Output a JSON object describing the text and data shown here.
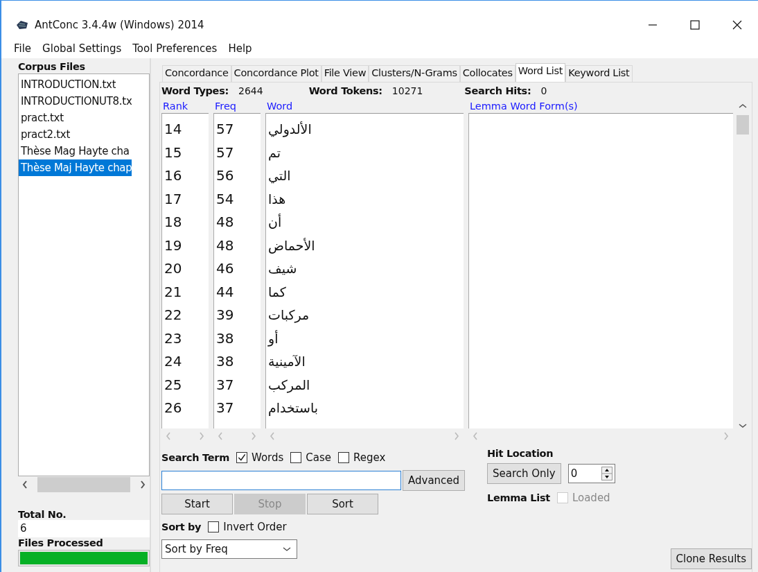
{
  "window": {
    "title": "AntConc 3.4.4w (Windows) 2014"
  },
  "menu": [
    "File",
    "Global Settings",
    "Tool Preferences",
    "Help"
  ],
  "corpus": {
    "title": "Corpus Files",
    "files": [
      {
        "name": "INTRODUCTION.txt",
        "selected": false
      },
      {
        "name": "INTRODUCTIONUT8.tx",
        "selected": false
      },
      {
        "name": "pract.txt",
        "selected": false
      },
      {
        "name": "pract2.txt",
        "selected": false
      },
      {
        "name": "Thèse Mag Hayte cha",
        "selected": false
      },
      {
        "name": "Thèse Maj Hayte chap",
        "selected": true
      }
    ],
    "total_label": "Total No.",
    "total": "6",
    "processed_label": "Files Processed",
    "level": 1
  },
  "tabs": [
    {
      "label": "Concordance",
      "selected": false
    },
    {
      "label": "Concordance Plot",
      "selected": false
    },
    {
      "label": "File View",
      "selected": false
    },
    {
      "label": "Clusters/N-Grams",
      "selected": false
    },
    {
      "label": "Collocates",
      "selected": false
    },
    {
      "label": "Word List",
      "selected": true
    },
    {
      "label": "Keyword List",
      "selected": false
    }
  ],
  "stats": [
    {
      "label": "Word Types:",
      "value": "2644"
    },
    {
      "label": "Word Tokens:",
      "value": "10271"
    },
    {
      "label": "Search Hits:",
      "value": "0"
    }
  ],
  "columns": [
    "Rank",
    "Freq",
    "Word",
    "Lemma Word Form(s)"
  ],
  "rows": [
    {
      "rank": "14",
      "freq": "57",
      "word": "الألدولي"
    },
    {
      "rank": "15",
      "freq": "57",
      "word": "تم"
    },
    {
      "rank": "16",
      "freq": "56",
      "word": "التي"
    },
    {
      "rank": "17",
      "freq": "54",
      "word": "هذا"
    },
    {
      "rank": "18",
      "freq": "48",
      "word": "أن"
    },
    {
      "rank": "19",
      "freq": "48",
      "word": "الأحماض"
    },
    {
      "rank": "20",
      "freq": "46",
      "word": "شيف"
    },
    {
      "rank": "21",
      "freq": "44",
      "word": "كما"
    },
    {
      "rank": "22",
      "freq": "39",
      "word": "مركبات"
    },
    {
      "rank": "23",
      "freq": "38",
      "word": "أو"
    },
    {
      "rank": "24",
      "freq": "38",
      "word": "الآمينية"
    },
    {
      "rank": "25",
      "freq": "37",
      "word": "المركب"
    },
    {
      "rank": "26",
      "freq": "37",
      "word": "باستخدام"
    }
  ],
  "search": {
    "label": "Search Term",
    "options": [
      {
        "label": "Words",
        "checked": true
      },
      {
        "label": "Case",
        "checked": false
      },
      {
        "label": "Regex",
        "checked": false
      }
    ],
    "advanced": "Advanced"
  },
  "actions": [
    {
      "label": "Start",
      "disabled": false
    },
    {
      "label": "Stop",
      "disabled": true
    },
    {
      "label": "Sort",
      "disabled": false
    }
  ],
  "sort": {
    "label": "Sort by",
    "invert": {
      "label": "Invert Order",
      "checked": false
    },
    "value": "Sort by Freq"
  },
  "hit_location": {
    "label": "Hit Location",
    "button": "Search Only",
    "value": "0"
  },
  "lemma": {
    "label": "Lemma List",
    "option": {
      "label": "Loaded",
      "checked": false,
      "disabled": true
    }
  },
  "clone": "Clone Results"
}
